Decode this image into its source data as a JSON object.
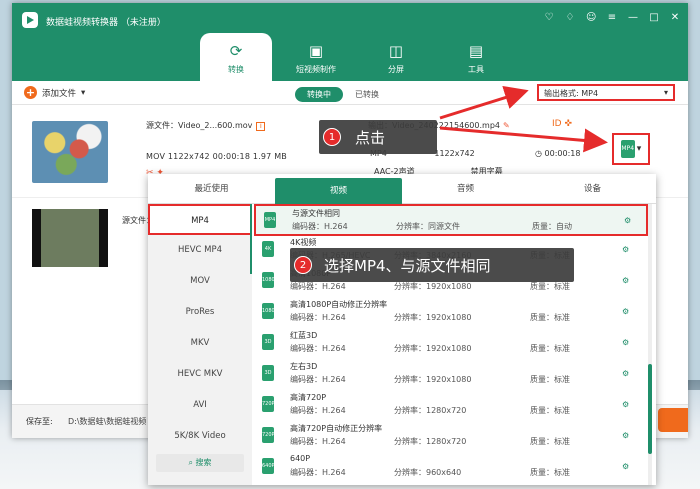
{
  "app": {
    "title": "数据蛙视频转换器 （未注册）",
    "window_controls": [
      "gift-icon",
      "tag-icon",
      "user-icon",
      "menu-icon",
      "minimize-icon",
      "maximize-icon",
      "close-icon"
    ]
  },
  "main_tabs": [
    {
      "label": "转换",
      "icon": "convert-icon",
      "active": true
    },
    {
      "label": "短视频制作",
      "icon": "video-make-icon",
      "active": false
    },
    {
      "label": "分屏",
      "icon": "split-icon",
      "active": false
    },
    {
      "label": "工具",
      "icon": "toolbox-icon",
      "active": false
    }
  ],
  "toolbar": {
    "add_file": "添加文件",
    "converting": "转换中",
    "converted": "已转换",
    "output_format_label": "输出格式:",
    "output_format_value": "MP4"
  },
  "file1": {
    "source": "源文件：Video_2...600.mov",
    "meta": "MOV  1122x742  00:00:18  1.97 MB",
    "output": "输出：Video_240222154600.mp4",
    "out_format": "MP4",
    "out_res": "1122x742",
    "out_time": "00:00:18",
    "audio": "AAC-2声道",
    "subtitle": "禁用字幕",
    "format_badge": "MP4"
  },
  "file2": {
    "source": "源文件：Video..."
  },
  "bottom": {
    "save_label": "保存至:",
    "save_path": "D:\\数据蛙\\数据蛙视频"
  },
  "popup": {
    "tabs": [
      "最近使用",
      "视频",
      "音频",
      "设备"
    ],
    "active_tab": 1,
    "formats": [
      "MP4",
      "HEVC MP4",
      "MOV",
      "ProRes",
      "MKV",
      "HEVC MKV",
      "AVI",
      "5K/8K Video"
    ],
    "search": "搜索",
    "options": [
      {
        "name": "与源文件相同",
        "encoder": "编码器：H.264",
        "res": "分辨率：同源文件",
        "quality": "质量：自动",
        "icon": "MP4"
      },
      {
        "name": "4K视频",
        "encoder": "编码器：H.265/HEVC",
        "res": "分辨率：3840x2160",
        "quality": "质量：标准",
        "icon": "4K"
      },
      {
        "name": "高清1080P",
        "encoder": "编码器：H.264",
        "res": "分辨率：1920x1080",
        "quality": "质量：标准",
        "icon": "1080P"
      },
      {
        "name": "高清1080P自动修正分辨率",
        "encoder": "编码器：H.264",
        "res": "分辨率：1920x1080",
        "quality": "质量：标准",
        "icon": "1080P"
      },
      {
        "name": "红蓝3D",
        "encoder": "编码器：H.264",
        "res": "分辨率：1920x1080",
        "quality": "质量：标准",
        "icon": "3D"
      },
      {
        "name": "左右3D",
        "encoder": "编码器：H.264",
        "res": "分辨率：1920x1080",
        "quality": "质量：标准",
        "icon": "3D"
      },
      {
        "name": "高清720P",
        "encoder": "编码器：H.264",
        "res": "分辨率：1280x720",
        "quality": "质量：标准",
        "icon": "720P"
      },
      {
        "name": "高清720P自动修正分辨率",
        "encoder": "编码器：H.264",
        "res": "分辨率：1280x720",
        "quality": "质量：标准",
        "icon": "720P"
      },
      {
        "name": "640P",
        "encoder": "编码器：H.264",
        "res": "分辨率：960x640",
        "quality": "质量：标准",
        "icon": "640P"
      }
    ]
  },
  "annotations": [
    {
      "num": "1",
      "text": "点击"
    },
    {
      "num": "2",
      "text": "选择MP4、与源文件相同"
    }
  ],
  "colors": {
    "brand": "#1f8e6a",
    "accent": "#f06a1c",
    "highlight": "#e52b2b"
  }
}
